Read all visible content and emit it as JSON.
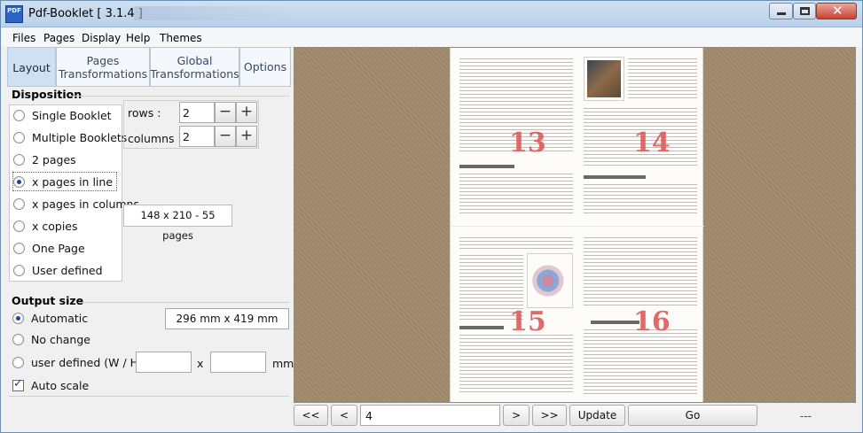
{
  "window": {
    "title": "Pdf-Booklet  [ 3.1.4 ]",
    "icon_text": "PDF"
  },
  "menu": [
    "Files",
    "Pages",
    "Display",
    "Help",
    "Themes"
  ],
  "tabs": [
    {
      "label": "Layout",
      "active": true
    },
    {
      "label": "Pages Transformations",
      "active": false
    },
    {
      "label": "Global Transformations",
      "active": false
    },
    {
      "label": "Options",
      "active": false
    }
  ],
  "disposition": {
    "title": "Disposition",
    "options": [
      {
        "label": "Single Booklet",
        "checked": false
      },
      {
        "label": "Multiple Booklets",
        "checked": false
      },
      {
        "label": "2 pages",
        "checked": false
      },
      {
        "label": "x pages in line",
        "checked": true
      },
      {
        "label": "x pages in columns",
        "checked": false
      },
      {
        "label": "x copies",
        "checked": false
      },
      {
        "label": "One Page",
        "checked": false
      },
      {
        "label": "User defined",
        "checked": false
      }
    ],
    "rows_label": "rows :",
    "rows_value": "2",
    "columns_label": "columns :",
    "columns_value": "2",
    "size_info": "148 x 210 - 55 pages"
  },
  "output": {
    "title": "Output size",
    "options": [
      {
        "label": "Automatic",
        "checked": true
      },
      {
        "label": "No change",
        "checked": false
      },
      {
        "label": "user defined (W / H)",
        "checked": false
      }
    ],
    "automatic_size": "296 mm x 419 mm",
    "width_value": "",
    "height_value": "",
    "separator": "x",
    "unit": "mm",
    "auto_scale_label": "Auto scale",
    "auto_scale_checked": true
  },
  "preview": {
    "page_numbers": [
      "13",
      "14",
      "15",
      "16"
    ],
    "headings": [
      "La révolution (1789 - 1799)",
      "La Nouvelle Assemblée",
      "La France depuis la révolution",
      "Politique et administration"
    ]
  },
  "navigation": {
    "first": "<<",
    "prev": "<",
    "page_value": "4",
    "next": ">",
    "last": ">>",
    "update": "Update",
    "go": "Go",
    "status": "---"
  }
}
